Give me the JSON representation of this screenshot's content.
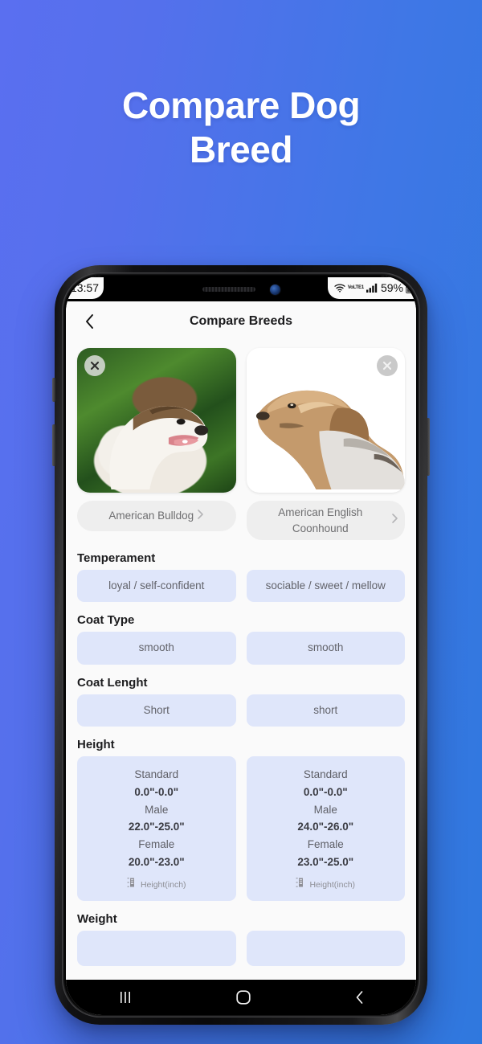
{
  "promo": {
    "headline_line1": "Compare Dog",
    "headline_line2": "Breed"
  },
  "status_bar": {
    "time": "13:57",
    "volte_label": "VoLTE1",
    "battery_percent": "59%",
    "wifi_icon": "wifi-icon",
    "signal_icon": "cellular-signal-icon",
    "battery_icon": "battery-icon"
  },
  "app_bar": {
    "title": "Compare Breeds",
    "back_icon": "back-chevron-icon"
  },
  "breeds": [
    {
      "name": "American Bulldog",
      "close_icon": "close-x-icon",
      "chevron_icon": "chevron-right-icon",
      "photo": "american-bulldog-photo"
    },
    {
      "name": "American English Coonhound",
      "close_icon": "close-x-icon",
      "chevron_icon": "chevron-right-icon",
      "photo": "american-english-coonhound-photo"
    }
  ],
  "attributes": [
    {
      "title": "Temperament",
      "values": [
        "loyal / self-confident",
        "sociable / sweet / mellow"
      ]
    },
    {
      "title": "Coat Type",
      "values": [
        "smooth",
        "smooth"
      ]
    },
    {
      "title": "Coat Lenght",
      "values": [
        "Short",
        "short"
      ]
    }
  ],
  "height_section": {
    "title": "Height",
    "unit_label": "Height(inch)",
    "unit_icon": "height-ruler-icon",
    "labels": {
      "standard": "Standard",
      "male": "Male",
      "female": "Female"
    },
    "columns": [
      {
        "standard": "0.0\"-0.0\"",
        "male": "22.0\"-25.0\"",
        "female": "20.0\"-23.0\""
      },
      {
        "standard": "0.0\"-0.0\"",
        "male": "24.0\"-26.0\"",
        "female": "23.0\"-25.0\""
      }
    ]
  },
  "weight_section": {
    "title": "Weight"
  },
  "nav_bar": {
    "recents_icon": "recents-icon",
    "home_icon": "home-icon",
    "back_icon": "nav-back-icon"
  },
  "colors": {
    "gradient_start": "#5570EC",
    "gradient_end": "#2F78DE",
    "value_box": "#DFE6FA",
    "pill": "#EEEEEE"
  }
}
